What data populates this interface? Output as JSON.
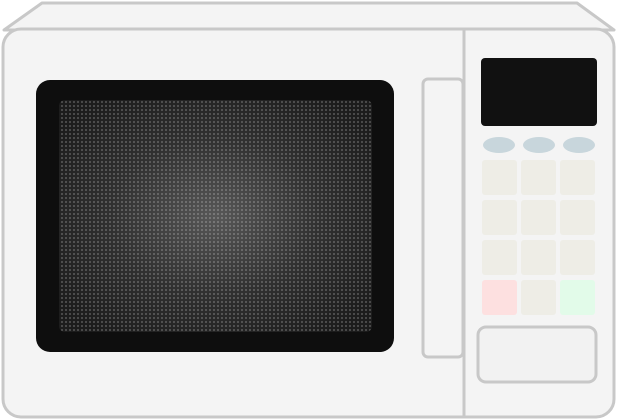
{
  "appliance": {
    "kind": "microwave-oven",
    "colors": {
      "body": "#f4f4f4",
      "body_outline": "#c8c8c8",
      "top_panel": "#f4f4f4",
      "door_frame": "#0e0e0e",
      "window_center": "#6a6a6a",
      "window_edge": "#222222",
      "handle": "#f4f4f4",
      "display": "#111111",
      "oval_button": "#c8d6dc",
      "keypad_button": "#eeede6",
      "stop_button": "#fde0e0",
      "start_button": "#e2fbe9",
      "open_button": "#f2f2f2"
    }
  },
  "control_panel": {
    "display_text": "",
    "oval_buttons": [
      {
        "name": "oval-button-left"
      },
      {
        "name": "oval-button-middle"
      },
      {
        "name": "oval-button-right"
      }
    ],
    "keypad": [
      {
        "name": "keypad-button-1",
        "color_key": "keypad_button"
      },
      {
        "name": "keypad-button-2",
        "color_key": "keypad_button"
      },
      {
        "name": "keypad-button-3",
        "color_key": "keypad_button"
      },
      {
        "name": "keypad-button-4",
        "color_key": "keypad_button"
      },
      {
        "name": "keypad-button-5",
        "color_key": "keypad_button"
      },
      {
        "name": "keypad-button-6",
        "color_key": "keypad_button"
      },
      {
        "name": "keypad-button-7",
        "color_key": "keypad_button"
      },
      {
        "name": "keypad-button-8",
        "color_key": "keypad_button"
      },
      {
        "name": "keypad-button-9",
        "color_key": "keypad_button"
      },
      {
        "name": "stop-button",
        "color_key": "stop_button"
      },
      {
        "name": "keypad-button-0",
        "color_key": "keypad_button"
      },
      {
        "name": "start-button",
        "color_key": "start_button"
      }
    ]
  }
}
